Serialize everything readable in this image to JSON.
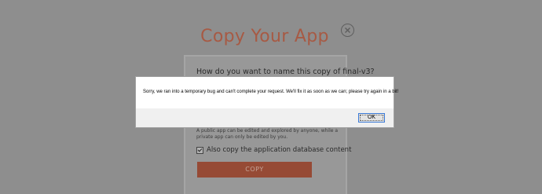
{
  "dialog": {
    "title": "Copy Your App",
    "question": "How do you want to name this copy of final-v3?",
    "help_text": "A public app can be edited and explored by anyone, while a private app can only be edited by you.",
    "checkbox_label": "Also copy the application database content",
    "checkbox_checked": true,
    "copy_button": "COPY",
    "close_icon": "close-icon"
  },
  "alert": {
    "message": "Sorry, we ran into a temporary bug and can't complete your request. We'll fix it as soon as we can; please try again in a bit!",
    "ok_button": "OK"
  },
  "colors": {
    "overlay": "#8e8e8e",
    "accent": "#a75a44",
    "button": "#964a35",
    "focus": "#3b7ad6"
  }
}
